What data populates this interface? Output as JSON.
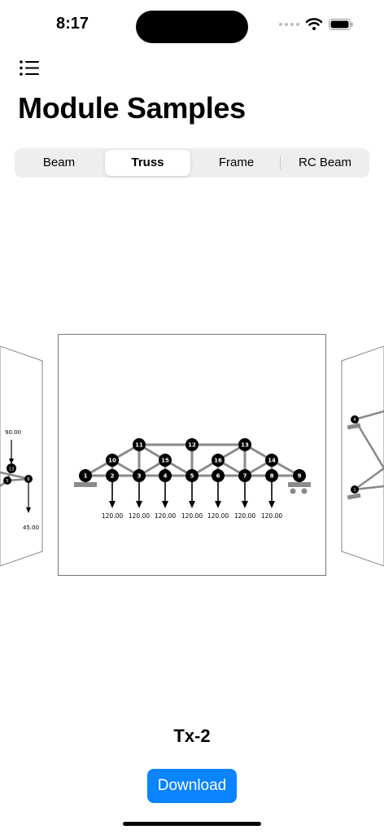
{
  "status": {
    "time": "8:17"
  },
  "page": {
    "title": "Module Samples"
  },
  "tabs": [
    {
      "label": "Beam"
    },
    {
      "label": "Truss"
    },
    {
      "label": "Frame"
    },
    {
      "label": "RC Beam"
    }
  ],
  "selected_tab": "Truss",
  "sample": {
    "name": "Tx-2",
    "download_label": "Download"
  },
  "truss": {
    "nodes": [
      "1",
      "2",
      "3",
      "4",
      "5",
      "6",
      "7",
      "8",
      "9",
      "10",
      "11",
      "12",
      "13",
      "14",
      "15",
      "16"
    ],
    "loads": [
      "120.00",
      "120.00",
      "120.00",
      "120.00",
      "120.00",
      "120.00",
      "120.00"
    ]
  },
  "left_preview": {
    "labels": [
      "90.00",
      "45.00",
      "13",
      "5",
      "6"
    ]
  },
  "right_preview": {
    "labels": [
      "4",
      "1"
    ]
  },
  "colors": {
    "accent": "#0a84ff",
    "member": "#8a8a8a",
    "node": "#000000"
  }
}
